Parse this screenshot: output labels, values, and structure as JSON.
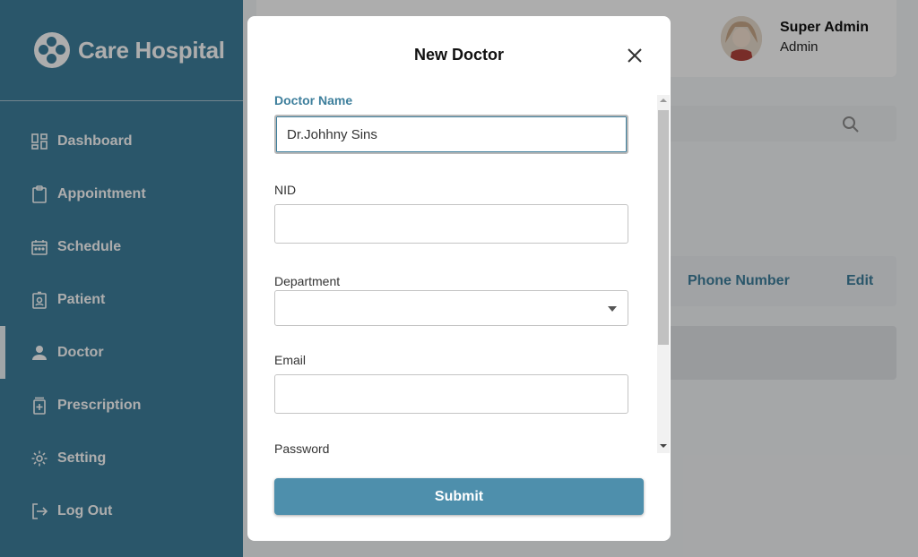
{
  "brand": {
    "name": "Care Hospital",
    "accent": "#3e7f9c"
  },
  "sidebar": {
    "items": [
      {
        "label": "Dashboard",
        "icon": "dashboard-icon"
      },
      {
        "label": "Appointment",
        "icon": "clipboard-icon"
      },
      {
        "label": "Schedule",
        "icon": "calendar-icon"
      },
      {
        "label": "Patient",
        "icon": "patient-badge-icon"
      },
      {
        "label": "Doctor",
        "icon": "person-icon",
        "active": true
      },
      {
        "label": "Prescription",
        "icon": "prescription-icon"
      },
      {
        "label": "Setting",
        "icon": "gear-icon"
      },
      {
        "label": "Log Out",
        "icon": "logout-icon"
      }
    ]
  },
  "header": {
    "user_name": "Super Admin",
    "user_role": "Admin"
  },
  "table": {
    "columns": [
      "Phone Number",
      "Edit"
    ]
  },
  "modal": {
    "title": "New Doctor",
    "fields": {
      "doctor_name": {
        "label": "Doctor Name",
        "value": "Dr.Johhny Sins"
      },
      "nid": {
        "label": "NID",
        "value": ""
      },
      "department": {
        "label": "Department",
        "value": ""
      },
      "email": {
        "label": "Email",
        "value": ""
      },
      "password": {
        "label": "Password"
      }
    },
    "submit_label": "Submit",
    "submit_color": "#4e8fac"
  }
}
